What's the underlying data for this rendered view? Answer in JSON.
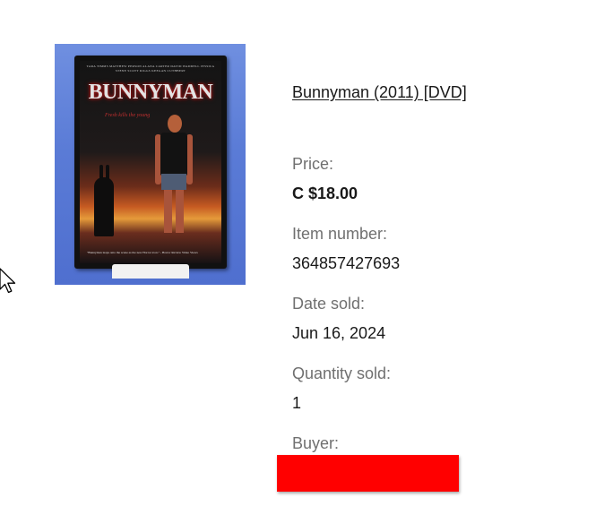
{
  "product": {
    "image_alt": "Bunnyman DVD cover",
    "cover": {
      "credits": "TARA TIMMS   MATTHEW PERSON   ALANA CARTER   DAVID WADDELL   JESSICA STENE   SCOTT RIGGS   KEEGAN CUTHBERT",
      "title": "BUNNYMAN",
      "tagline": "Fresh kills the young",
      "quote": "\"Bunnyman leaps onto the scene as the new Horror icon.\" - Horror Review Video Views"
    },
    "title": "Bunnyman (2011) [DVD]"
  },
  "fields": [
    {
      "label": "Price:",
      "value": "C $18.00"
    },
    {
      "label": "Item number:",
      "value": "364857427693"
    },
    {
      "label": "Date sold:",
      "value": "Jun 16, 2024"
    },
    {
      "label": "Quantity sold:",
      "value": "1"
    },
    {
      "label": "Buyer:",
      "value": ""
    }
  ],
  "colors": {
    "redaction": "#ff0000",
    "label_gray": "#707070",
    "text_dark": "#191919"
  },
  "icons": {
    "cursor": "arrow-cursor-icon"
  }
}
